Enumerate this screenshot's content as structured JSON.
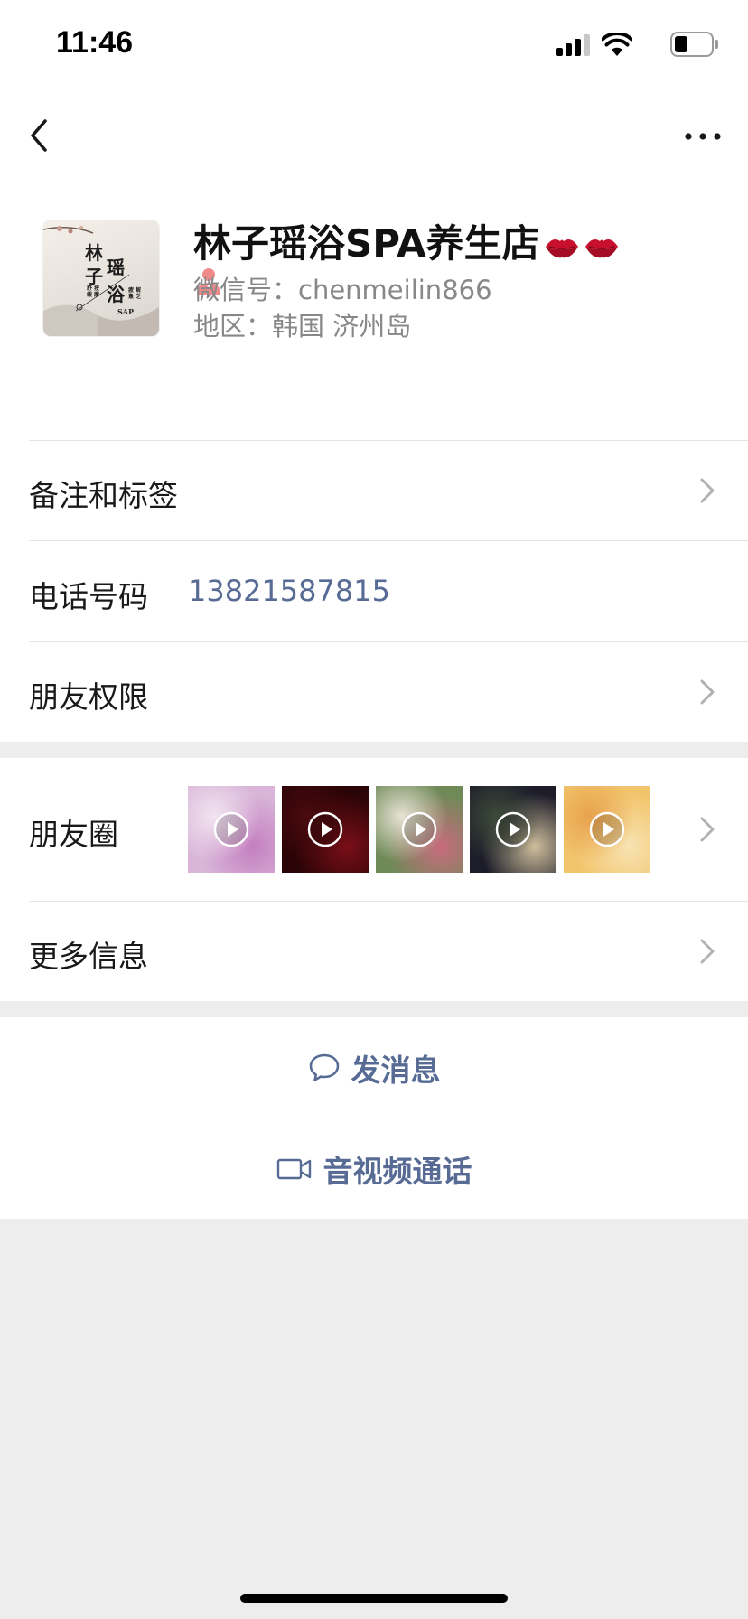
{
  "status_bar": {
    "time": "11:46",
    "icons": [
      "signal-icon",
      "wifi-icon",
      "battery-icon"
    ]
  },
  "nav": {
    "back_icon": "chevron-left-icon",
    "more_icon": "more-dots-icon"
  },
  "profile": {
    "name": "林子瑶浴SPA养生店",
    "name_emojis": [
      "lips-icon",
      "lips-icon"
    ],
    "badge_icon": "waiter-icon",
    "wechat_id_line": "微信号：chenmeilin866",
    "region_line": "地区：韩国 济州岛",
    "avatar_text": {
      "big1": "林",
      "big2": "子",
      "big3": "瑶",
      "big4": "浴",
      "small": "SAP",
      "small_cols": [
        "舒缓",
        "按摩",
        "疲惫",
        "解乏"
      ]
    }
  },
  "rows": {
    "remarks_label": "备注和标签",
    "phone_label": "电话号码",
    "phone_value": "13821587815",
    "permissions_label": "朋友权限",
    "moments_label": "朋友圈",
    "more_info_label": "更多信息"
  },
  "moments": {
    "thumbs": [
      {
        "name": "moment-thumb-1",
        "colors": [
          "#d9b6d9",
          "#c47fc0",
          "#f2e4f0"
        ]
      },
      {
        "name": "moment-thumb-2",
        "colors": [
          "#2a0406",
          "#7a0f18",
          "#4a0a0e"
        ]
      },
      {
        "name": "moment-thumb-3",
        "colors": [
          "#6f8a57",
          "#c86b7e",
          "#e9e3d6"
        ]
      },
      {
        "name": "moment-thumb-4",
        "colors": [
          "#1d1d2a",
          "#cdbd9b",
          "#3d4a3a"
        ]
      },
      {
        "name": "moment-thumb-5",
        "colors": [
          "#f2c56c",
          "#f7e3b2",
          "#e8a24f"
        ]
      }
    ]
  },
  "actions": {
    "message_label": "发消息",
    "message_icon": "chat-bubble-icon",
    "call_label": "音视频通话",
    "call_icon": "video-camera-icon"
  },
  "colors": {
    "link_blue": "#576b95",
    "background_gray": "#ededed",
    "separator": "#e5e5e5"
  }
}
